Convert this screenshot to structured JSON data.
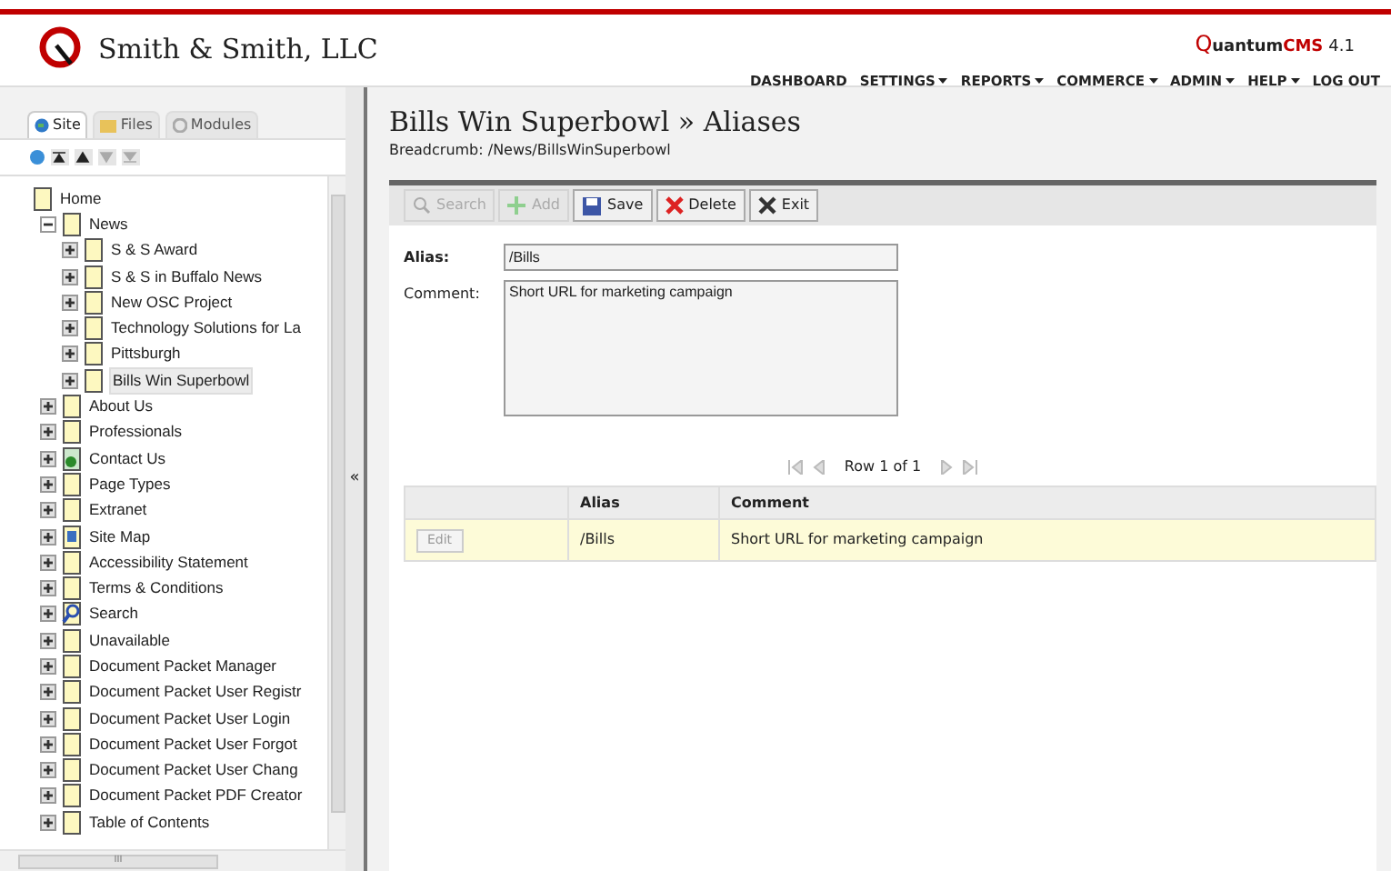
{
  "header": {
    "company": "Smith & Smith, LLC",
    "brand": {
      "q": "Q",
      "name": "uantum",
      "cms": "CMS",
      "version": "4.1"
    },
    "nav": [
      {
        "label": "DASHBOARD",
        "menu": false
      },
      {
        "label": "SETTINGS",
        "menu": true
      },
      {
        "label": "REPORTS",
        "menu": true
      },
      {
        "label": "COMMERCE",
        "menu": true
      },
      {
        "label": "ADMIN",
        "menu": true
      },
      {
        "label": "HELP",
        "menu": true
      },
      {
        "label": "LOG OUT",
        "menu": false
      }
    ]
  },
  "sidebar": {
    "tabs": [
      {
        "label": "Site",
        "selected": true
      },
      {
        "label": "Files",
        "selected": false
      },
      {
        "label": "Modules",
        "selected": false
      }
    ],
    "tree": [
      {
        "label": "Home",
        "kind": "root",
        "selected": false
      },
      {
        "label": "News",
        "kind": "page",
        "expanded": true,
        "selected": false,
        "children": [
          {
            "label": "S & S Award",
            "kind": "page",
            "expanded": false,
            "selected": false
          },
          {
            "label": "S & S in Buffalo News",
            "kind": "page",
            "expanded": false,
            "selected": false
          },
          {
            "label": "New OSC Project",
            "kind": "page",
            "expanded": false,
            "selected": false
          },
          {
            "label": "Technology Solutions for La",
            "kind": "page",
            "expanded": false,
            "selected": false
          },
          {
            "label": "Pittsburgh",
            "kind": "page",
            "expanded": false,
            "selected": false
          },
          {
            "label": "Bills Win Superbowl",
            "kind": "page",
            "expanded": false,
            "selected": true
          }
        ]
      },
      {
        "label": "About Us",
        "kind": "page",
        "expanded": false,
        "selected": false
      },
      {
        "label": "Professionals",
        "kind": "page",
        "expanded": false,
        "selected": false
      },
      {
        "label": "Contact Us",
        "kind": "contact",
        "expanded": false,
        "selected": false
      },
      {
        "label": "Page Types",
        "kind": "page",
        "expanded": false,
        "selected": false
      },
      {
        "label": "Extranet",
        "kind": "page",
        "expanded": false,
        "selected": false
      },
      {
        "label": "Site Map",
        "kind": "sitemap",
        "expanded": false,
        "selected": false
      },
      {
        "label": "Accessibility Statement",
        "kind": "page",
        "expanded": false,
        "selected": false
      },
      {
        "label": "Terms & Conditions",
        "kind": "page",
        "expanded": false,
        "selected": false
      },
      {
        "label": "Search",
        "kind": "search",
        "expanded": false,
        "selected": false
      },
      {
        "label": "Unavailable",
        "kind": "page",
        "expanded": false,
        "selected": false
      },
      {
        "label": "Document Packet Manager",
        "kind": "page",
        "expanded": false,
        "selected": false
      },
      {
        "label": "Document Packet User Registr",
        "kind": "page",
        "expanded": false,
        "selected": false
      },
      {
        "label": "Document Packet User Login",
        "kind": "page",
        "expanded": false,
        "selected": false
      },
      {
        "label": "Document Packet User Forgot",
        "kind": "page",
        "expanded": false,
        "selected": false
      },
      {
        "label": "Document Packet User Chang",
        "kind": "page",
        "expanded": false,
        "selected": false
      },
      {
        "label": "Document Packet PDF Creator",
        "kind": "page",
        "expanded": false,
        "selected": false
      },
      {
        "label": "Table of Contents",
        "kind": "page",
        "expanded": false,
        "selected": false
      }
    ],
    "collapse": "«",
    "scroll_grip": "III"
  },
  "main": {
    "title": "Bills Win Superbowl » Aliases",
    "breadcrumb": "Breadcrumb: /News/BillsWinSuperbowl",
    "toolbar": [
      {
        "label": "Search",
        "kind": "search",
        "disabled": true
      },
      {
        "label": "Add",
        "kind": "add",
        "disabled": true
      },
      {
        "label": "Save",
        "kind": "save",
        "disabled": false
      },
      {
        "label": "Delete",
        "kind": "delete",
        "disabled": false
      },
      {
        "label": "Exit",
        "kind": "exit",
        "disabled": false
      }
    ],
    "form": {
      "alias_label": "Alias:",
      "alias": "/Bills",
      "comment_label": "Comment:",
      "comment": "Short URL for marketing campaign"
    },
    "pager": "Row 1 of 1",
    "table": {
      "columns": [
        "Alias",
        "Comment"
      ],
      "rows": [
        {
          "button": "Edit",
          "alias": "/Bills",
          "comment": "Short URL for marketing campaign",
          "selected": true
        }
      ]
    }
  }
}
